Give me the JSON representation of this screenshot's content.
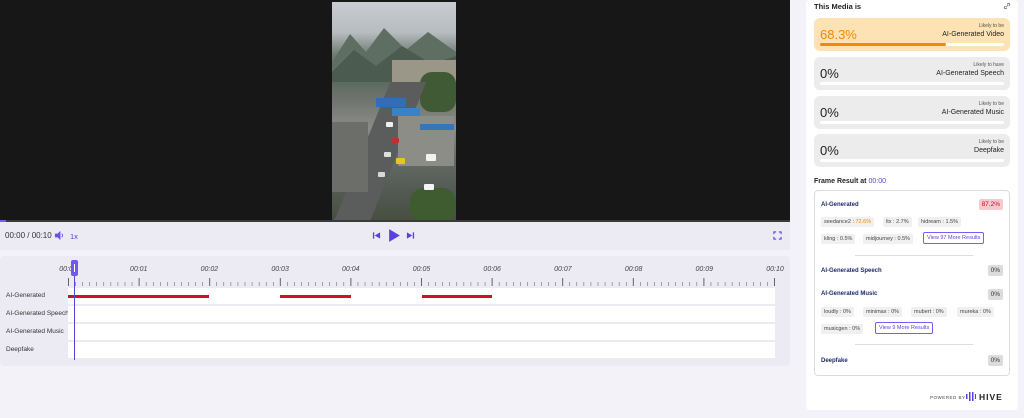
{
  "player": {
    "time_display": "00:00 / 00:10",
    "speed": "1x"
  },
  "timeline": {
    "ticks": [
      "00:00",
      "00:01",
      "00:02",
      "00:03",
      "00:04",
      "00:05",
      "00:06",
      "00:07",
      "00:08",
      "00:09",
      "00:10"
    ],
    "tracks": [
      {
        "label": "AI-Generated",
        "segments": [
          [
            0,
            2
          ],
          [
            3,
            4
          ],
          [
            5,
            6
          ]
        ]
      },
      {
        "label": "AI-Generated Speech",
        "segments": []
      },
      {
        "label": "AI-Generated Music",
        "segments": []
      },
      {
        "label": "Deepfake",
        "segments": []
      }
    ],
    "duration_seconds": 10,
    "playhead_seconds": 0,
    "segment_color": "#d0102a",
    "playhead_color": "#5b3fe0"
  },
  "panel": {
    "title": "This Media is",
    "cards": [
      {
        "value": "68.3%",
        "small": "Likely to be",
        "big": "AI-Generated Video",
        "fill": 0.683,
        "highlight": true
      },
      {
        "value": "0%",
        "small": "Likely to have",
        "big": "AI-Generated Speech",
        "fill": 0,
        "highlight": false
      },
      {
        "value": "0%",
        "small": "Likely to be",
        "big": "AI-Generated Music",
        "fill": 0,
        "highlight": false
      },
      {
        "value": "0%",
        "small": "Likely to be",
        "big": "Deepfake",
        "fill": 0,
        "highlight": false
      }
    ],
    "frame_result_label": "Frame Result at",
    "frame_result_time": "00:00",
    "sections": {
      "ai_generated": {
        "title": "AI-Generated",
        "badge": "87.2%",
        "chips": [
          {
            "name": "seedance2 :",
            "value": "72.6%"
          },
          {
            "name": "ltx :",
            "value": "2.7%"
          },
          {
            "name": "hidream :",
            "value": "1.5%"
          },
          {
            "name": "kling :",
            "value": "0.5%"
          },
          {
            "name": "midjourney :",
            "value": "0.5%"
          }
        ],
        "more": "View 97 More Results"
      },
      "speech": {
        "title": "AI-Generated Speech",
        "badge": "0%"
      },
      "music": {
        "title": "AI-Generated Music",
        "badge": "0%",
        "chips": [
          {
            "name": "loudly :",
            "value": "0%"
          },
          {
            "name": "minimax :",
            "value": "0%"
          },
          {
            "name": "mubert :",
            "value": "0%"
          },
          {
            "name": "mureka :",
            "value": "0%"
          },
          {
            "name": "musicgen :",
            "value": "0%"
          }
        ],
        "more": "View 9 More Results"
      },
      "deepfake": {
        "title": "Deepfake",
        "badge": "0%"
      }
    },
    "powered_by": "POWERED BY",
    "brand": "HIVE",
    "accent_color": "#f08a00",
    "brand_color": "#5b3fe0"
  }
}
